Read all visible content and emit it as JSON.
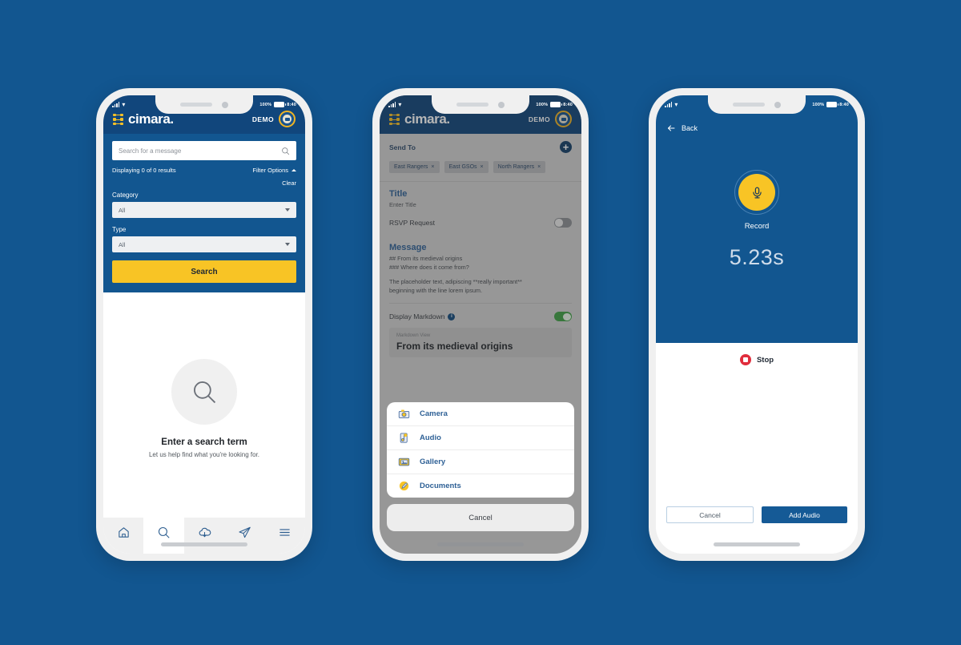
{
  "background_color": "#125690",
  "brand": {
    "name": "cimara.",
    "demo_label": "DEMO"
  },
  "status_bar": {
    "battery_percent": "100%",
    "time": "8:40"
  },
  "phone1": {
    "search": {
      "placeholder": "Search for a message",
      "results_text": "Displaying 0 of 0 results",
      "filter_options_label": "Filter Options",
      "clear_label": "Clear",
      "category_label": "Category",
      "category_value": "All",
      "type_label": "Type",
      "type_value": "All",
      "search_button": "Search"
    },
    "empty_state": {
      "title": "Enter a search term",
      "subtitle": "Let us help find what you're looking for."
    },
    "tabs": [
      {
        "name": "home",
        "icon": "home-icon",
        "active": false
      },
      {
        "name": "search",
        "icon": "search-icon",
        "active": true
      },
      {
        "name": "downloads",
        "icon": "cloud-download-icon",
        "active": false
      },
      {
        "name": "send",
        "icon": "paper-plane-icon",
        "active": false
      },
      {
        "name": "menu",
        "icon": "hamburger-menu-icon",
        "active": false
      }
    ]
  },
  "phone2": {
    "send_to_label": "Send To",
    "recipients": [
      {
        "label": "East Rangers"
      },
      {
        "label": "East GSOs"
      },
      {
        "label": "North Rangers"
      }
    ],
    "title_label": "Title",
    "title_placeholder": "Enter Title",
    "rsvp_label": "RSVP Request",
    "rsvp_on": false,
    "message_label": "Message",
    "message_lines": [
      "## From its medieval origins",
      "### Where does it come from?",
      "",
      "The placeholder text, adipiscing **really important**",
      "beginning with the line lorem ipsum."
    ],
    "display_markdown_label": "Display Markdown",
    "display_markdown_on": true,
    "markdown_view_label": "Markdown View",
    "markdown_view_heading": "From its medieval origins",
    "action_sheet": {
      "items": [
        {
          "label": "Camera",
          "icon": "camera-icon"
        },
        {
          "label": "Audio",
          "icon": "audio-icon"
        },
        {
          "label": "Gallery",
          "icon": "gallery-icon"
        },
        {
          "label": "Documents",
          "icon": "documents-icon"
        }
      ],
      "cancel_label": "Cancel"
    }
  },
  "phone3": {
    "back_label": "Back",
    "record_label": "Record",
    "timer": "5.23s",
    "stop_label": "Stop",
    "cancel_label": "Cancel",
    "add_audio_label": "Add Audio"
  }
}
